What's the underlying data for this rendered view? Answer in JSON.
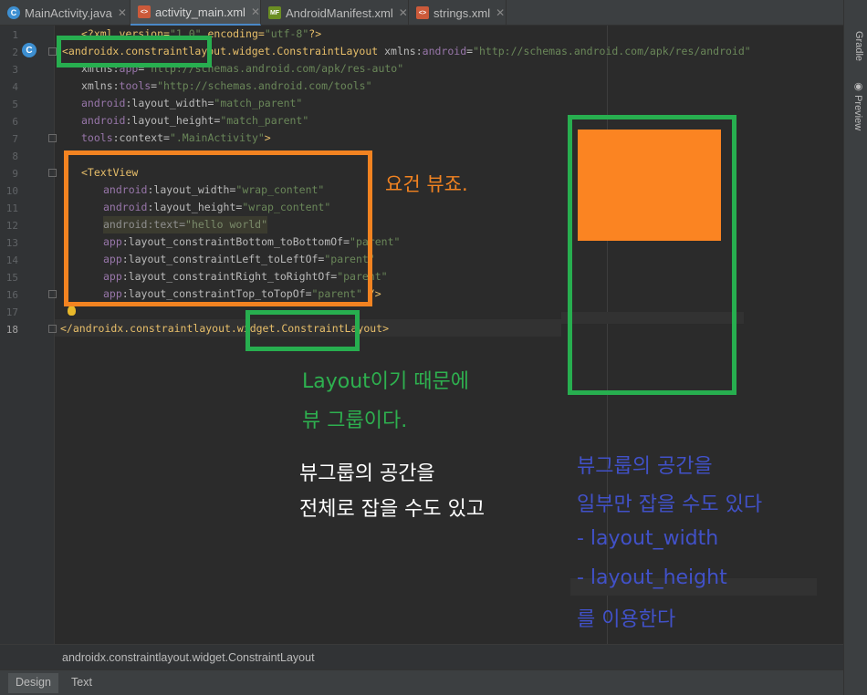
{
  "tabs": [
    {
      "label": "MainActivity.java",
      "icon": "java-class-icon",
      "badge": "C"
    },
    {
      "label": "activity_main.xml",
      "icon": "layout-xml-icon",
      "badge": "<>"
    },
    {
      "label": "AndroidManifest.xml",
      "icon": "manifest-icon",
      "badge": "MF"
    },
    {
      "label": "strings.xml",
      "icon": "values-xml-icon",
      "badge": "<>"
    }
  ],
  "right_panel": {
    "gradle": "Gradle",
    "preview": "Preview"
  },
  "line_numbers": [
    "1",
    "2",
    "3",
    "4",
    "5",
    "6",
    "7",
    "8",
    "9",
    "10",
    "11",
    "12",
    "13",
    "14",
    "15",
    "16",
    "17",
    "18"
  ],
  "code": {
    "l1": [
      "<?xml version=",
      "\"1.0\"",
      " encoding=",
      "\"utf-8\"",
      "?>"
    ],
    "l2": [
      "<androidx.constraintlayout.widget.ConstraintLayout",
      " xmlns:",
      "android",
      "=",
      "\"http://schemas.android.com/apk/res/android\""
    ],
    "l3": [
      "xmlns:",
      "app",
      "=",
      "\"http://schemas.android.com/apk/res-auto\""
    ],
    "l4": [
      "xmlns:",
      "tools",
      "=",
      "\"http://schemas.android.com/tools\""
    ],
    "l5": [
      "android",
      ":layout_width=",
      "\"match_parent\""
    ],
    "l6": [
      "android",
      ":layout_height=",
      "\"match_parent\""
    ],
    "l7": [
      "tools",
      ":context=",
      "\".MainActivity\"",
      ">"
    ],
    "l9": [
      "<TextView"
    ],
    "l10": [
      "android",
      ":layout_width=",
      "\"wrap_content\""
    ],
    "l11": [
      "android",
      ":layout_height=",
      "\"wrap_content\""
    ],
    "l12": [
      "android",
      ":text=",
      "\"hello world\""
    ],
    "l13": [
      "app",
      ":layout_constraintBottom_toBottomOf=",
      "\"parent\""
    ],
    "l14": [
      "app",
      ":layout_constraintLeft_toLeftOf=",
      "\"parent\""
    ],
    "l15": [
      "app",
      ":layout_constraintRight_toRightOf=",
      "\"parent\""
    ],
    "l16": [
      "app",
      ":layout_constraintTop_toTopOf=",
      "\"parent\"",
      " />"
    ],
    "l18": [
      "</androidx.constraintlayout.widget.ConstraintLayout>"
    ]
  },
  "annotations": {
    "orange_note": "요건 뷰죠.",
    "green_note_1": "Layout이기 때문에",
    "green_note_2": "뷰 그룹이다.",
    "white_note_1": "뷰그룹의 공간을",
    "white_note_2": "전체로 잡을 수도 있고",
    "blue_note_1": "뷰그룹의 공간을",
    "blue_note_2": "일부만 잡을 수도 있다",
    "blue_note_3": "- layout_width",
    "blue_note_4": "- layout_height",
    "blue_note_5": "를 이용한다"
  },
  "breadcrumb": "androidx.constraintlayout.widget.ConstraintLayout",
  "bottom_tabs": [
    "Design",
    "Text"
  ],
  "colors": {
    "green": "#27ae4f",
    "orange": "#f28321",
    "blue": "#4151c8",
    "editor_bg": "#2b2b2b"
  }
}
